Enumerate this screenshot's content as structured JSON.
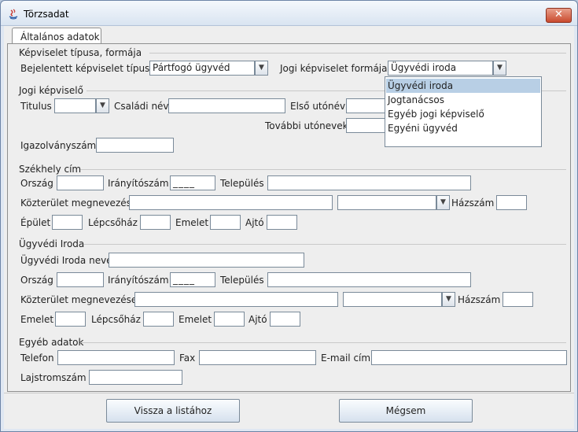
{
  "window": {
    "title": "Törzsadat",
    "close_glyph": "✕"
  },
  "tabs": [
    {
      "label": "Általános adatok",
      "selected": true
    }
  ],
  "representation": {
    "section_title": "Képviselet típusa, formája",
    "type_label": "Bejelentett képviselet típusa",
    "type_value": "Pártfogó ügyvéd",
    "form_label": "Jogi képviselet formája",
    "form_value": "Ügyvédi iroda",
    "form_options": [
      "Ügyvédi iroda",
      "Jogtanácsos",
      "Egyéb jogi képviselő",
      "Egyéni ügyvéd"
    ]
  },
  "legal_rep": {
    "section_title": "Jogi képviselő",
    "title_label": "Titulus",
    "family_name_label": "Családi név",
    "first_given_label": "Első utónév",
    "other_given_label": "További utónevek",
    "id_number_label": "Igazolványszám"
  },
  "seat": {
    "section_title": "Székhely cím",
    "country_label": "Ország",
    "postal_label": "Irányítószám",
    "postal_mask": "____",
    "city_label": "Település",
    "street_label": "Közterület megnevezés",
    "house_label": "Házszám",
    "building_label": "Épület",
    "stair_label": "Lépcsőház",
    "floor_label": "Emelet",
    "door_label": "Ajtó"
  },
  "office": {
    "section_title": "Ügyvédi Iroda",
    "name_label": "Ügyvédi Iroda neve",
    "country_label": "Ország",
    "postal_label": "Irányítószám",
    "postal_mask": "____",
    "city_label": "Település",
    "street_label": "Közterület megnevezése",
    "house_label": "Házszám",
    "floor_label": "Emelet",
    "stair_label": "Lépcsőház",
    "floor2_label": "Emelet",
    "door_label": "Ajtó"
  },
  "other": {
    "section_title": "Egyéb adatok",
    "phone_label": "Telefon",
    "fax_label": "Fax",
    "email_label": "E-mail cím",
    "registry_label": "Lajstromszám"
  },
  "buttons": {
    "back_label": "Vissza a listához",
    "cancel_label": "Mégsem"
  },
  "icons": {
    "dropdown": "chevron-down-icon",
    "app": "java-app-icon",
    "close": "close-icon"
  }
}
